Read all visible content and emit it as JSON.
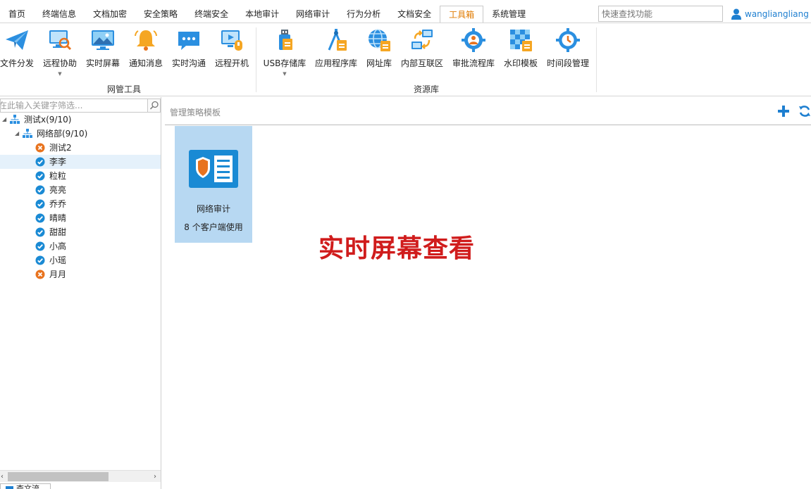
{
  "tabs": [
    {
      "label": "首页"
    },
    {
      "label": "终端信息"
    },
    {
      "label": "文档加密"
    },
    {
      "label": "安全策略"
    },
    {
      "label": "终端安全"
    },
    {
      "label": "本地审计"
    },
    {
      "label": "网络审计"
    },
    {
      "label": "行为分析"
    },
    {
      "label": "文档安全"
    },
    {
      "label": "工具箱"
    },
    {
      "label": "系统管理"
    }
  ],
  "active_tab": "工具箱",
  "search": {
    "placeholder": "快速查找功能"
  },
  "user": {
    "name": "wangliangliang"
  },
  "ribbon": {
    "groups": [
      {
        "label": "网管工具"
      },
      {
        "label": "资源库"
      }
    ],
    "tools": [
      {
        "label": "文件分发",
        "icon": "paper-plane-icon"
      },
      {
        "label": "远程协助",
        "icon": "remote-assist-icon",
        "dropdown": true
      },
      {
        "label": "实时屏幕",
        "icon": "screen-icon"
      },
      {
        "label": "通知消息",
        "icon": "bell-icon"
      },
      {
        "label": "实时沟通",
        "icon": "chat-icon"
      },
      {
        "label": "远程开机",
        "icon": "remote-power-icon"
      },
      {
        "label": "USB存储库",
        "icon": "usb-icon",
        "dropdown": true
      },
      {
        "label": "应用程序库",
        "icon": "app-library-icon"
      },
      {
        "label": "网址库",
        "icon": "globe-icon"
      },
      {
        "label": "内部互联区",
        "icon": "network-icon"
      },
      {
        "label": "审批流程库",
        "icon": "approval-gear-icon"
      },
      {
        "label": "水印模板",
        "icon": "watermark-icon"
      },
      {
        "label": "时间段管理",
        "icon": "clock-gear-icon"
      }
    ]
  },
  "left_panel": {
    "filter_placeholder": "在此输入关键字筛选...",
    "tree": [
      {
        "label": "测试x(9/10)",
        "type": "org",
        "level": 0
      },
      {
        "label": "网络部(9/10)",
        "type": "org",
        "level": 1
      },
      {
        "label": "测试2",
        "type": "offline",
        "level": 2
      },
      {
        "label": "李李",
        "type": "online",
        "level": 2,
        "selected": true
      },
      {
        "label": "粒粒",
        "type": "online",
        "level": 2
      },
      {
        "label": "亮亮",
        "type": "online",
        "level": 2
      },
      {
        "label": "乔乔",
        "type": "online",
        "level": 2
      },
      {
        "label": "晴晴",
        "type": "online",
        "level": 2
      },
      {
        "label": "甜甜",
        "type": "online",
        "level": 2
      },
      {
        "label": "小高",
        "type": "online",
        "level": 2
      },
      {
        "label": "小瑶",
        "type": "online",
        "level": 2
      },
      {
        "label": "月月",
        "type": "offline",
        "level": 2
      }
    ],
    "bottom_tab": "查文流"
  },
  "right_panel": {
    "title": "管理策略模板",
    "cards": [
      {
        "name": "网络审计",
        "usage": "8 个客户端使用"
      }
    ],
    "banner": "实时屏幕查看"
  },
  "colors": {
    "accent_tab": "#e07b00",
    "user_link": "#1e7fd0",
    "card_bg": "#b7d8f2",
    "banner": "#d01c1c",
    "online": "#1a8ad4",
    "offline": "#e8731e"
  }
}
